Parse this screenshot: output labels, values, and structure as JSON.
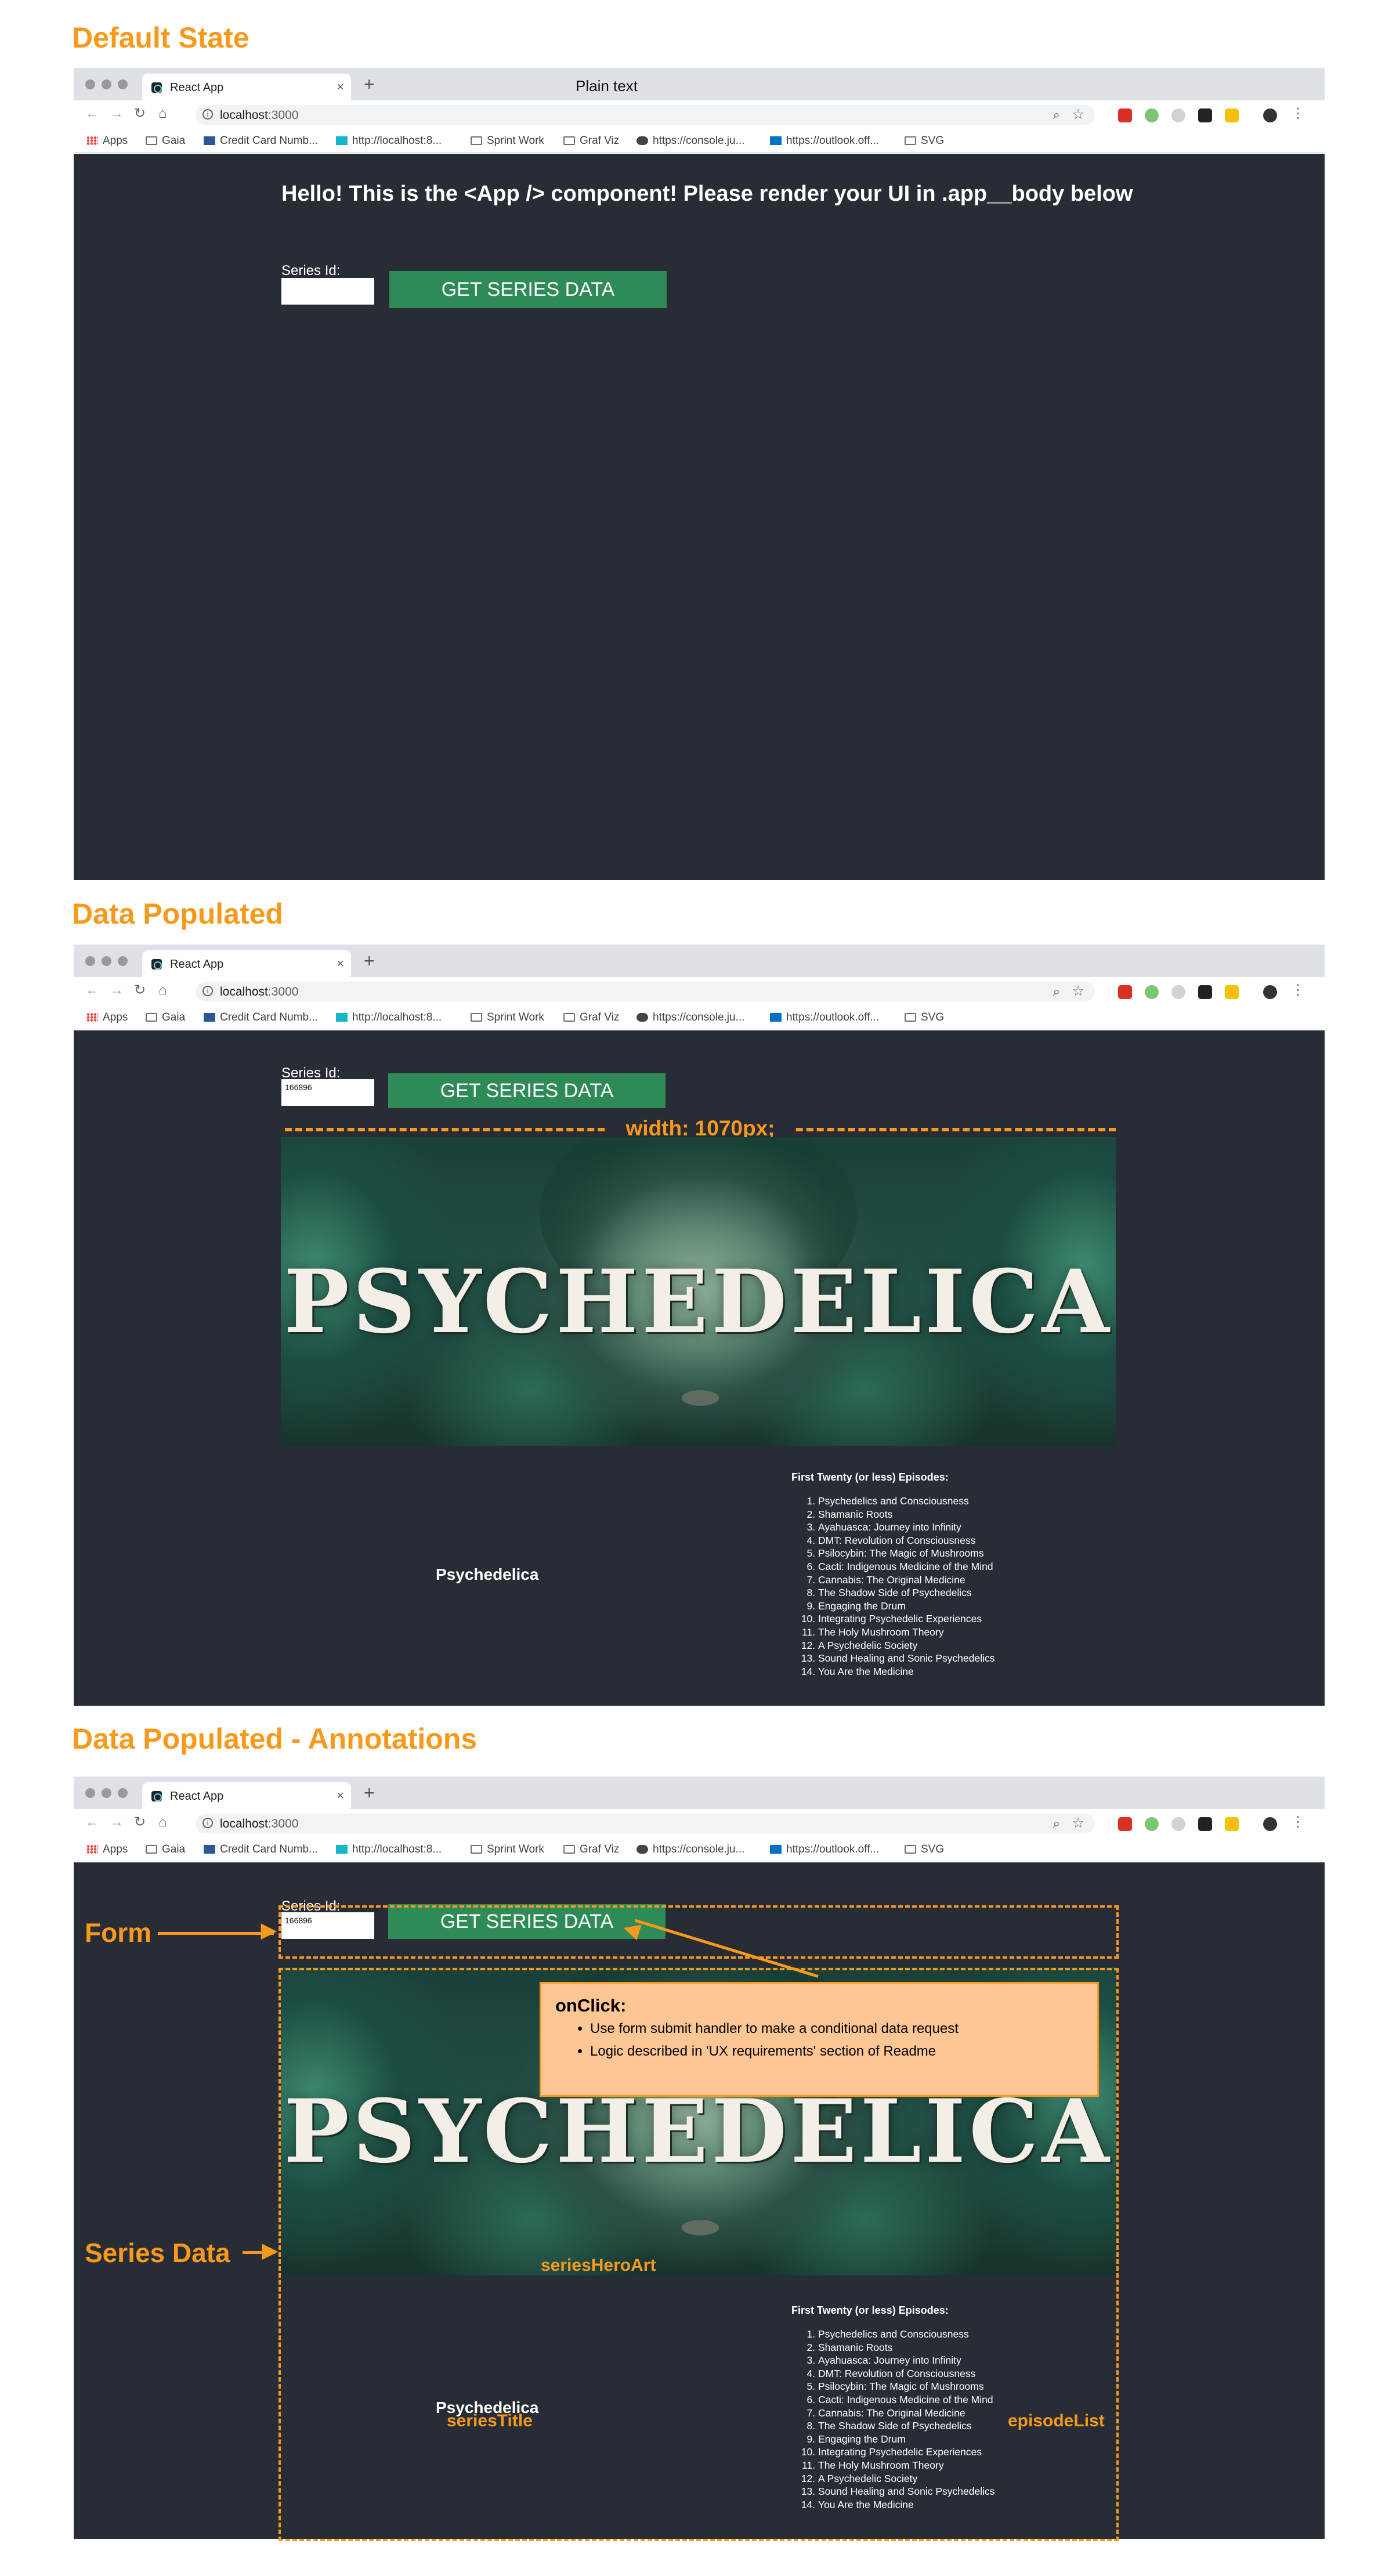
{
  "sections": {
    "default_heading": "Default State",
    "populated_heading": "Data Populated",
    "annotations_heading": "Data Populated - Annotations"
  },
  "browser": {
    "tab_title": "React App",
    "tab_close": "×",
    "new_tab": "+",
    "plain_text": "Plain text",
    "url_host": "localhost",
    "url_port": ":3000",
    "bookmarks": [
      {
        "label": "Apps",
        "icon": "apps-grid-icon"
      },
      {
        "label": "Gaia",
        "icon": "folder-icon"
      },
      {
        "label": "Credit Card Numb...",
        "icon": "card-icon"
      },
      {
        "label": "http://localhost:8...",
        "icon": "g-icon"
      },
      {
        "label": "Sprint Work",
        "icon": "folder-icon"
      },
      {
        "label": "Graf Viz",
        "icon": "folder-icon"
      },
      {
        "label": "https://console.ju...",
        "icon": "cloud-icon"
      },
      {
        "label": "https://outlook.off...",
        "icon": "outlook-icon"
      },
      {
        "label": "SVG",
        "icon": "folder-icon"
      }
    ]
  },
  "app": {
    "hello_text": "Hello! This is the <App /> component! Please render your UI in .app__body below",
    "series_id_label": "Series Id:",
    "series_id_value": "166896",
    "button_label": "GET SERIES DATA",
    "hero_text": "PSYCHEDELICA",
    "series_title": "Psychedelica",
    "episode_heading": "First Twenty (or less) Episodes:",
    "episodes": [
      "Psychedelics and Consciousness",
      "Shamanic Roots",
      "Ayahuasca: Journey into Infinity",
      "DMT: Revolution of Consciousness",
      "Psilocybin: The Magic of Mushrooms",
      "Cacti: Indigenous Medicine of the Mind",
      "Cannabis: The Original Medicine",
      "The Shadow Side of Psychedelics",
      "Engaging the Drum",
      "Integrating Psychedelic Experiences",
      "The Holy Mushroom Theory",
      "A Psychedelic Society",
      "Sound Healing and Sonic Psychedelics",
      "You Are the Medicine"
    ]
  },
  "annotations": {
    "width_label": "width: 1070px;",
    "form_label": "Form",
    "series_data_label": "Series Data",
    "hero_art_label": "seriesHeroArt",
    "title_label": "seriesTitle",
    "episode_list_label": "episodeList",
    "callout_title": "onClick:",
    "callout_items": [
      "Use form submit handler to make a conditional data request",
      "Logic described in 'UX requirements' section of Readme"
    ]
  },
  "colors": {
    "annotation": "#f79a1c",
    "app_bg": "#282c34",
    "button": "#2e8b57",
    "callout_bg": "#fcc695"
  }
}
